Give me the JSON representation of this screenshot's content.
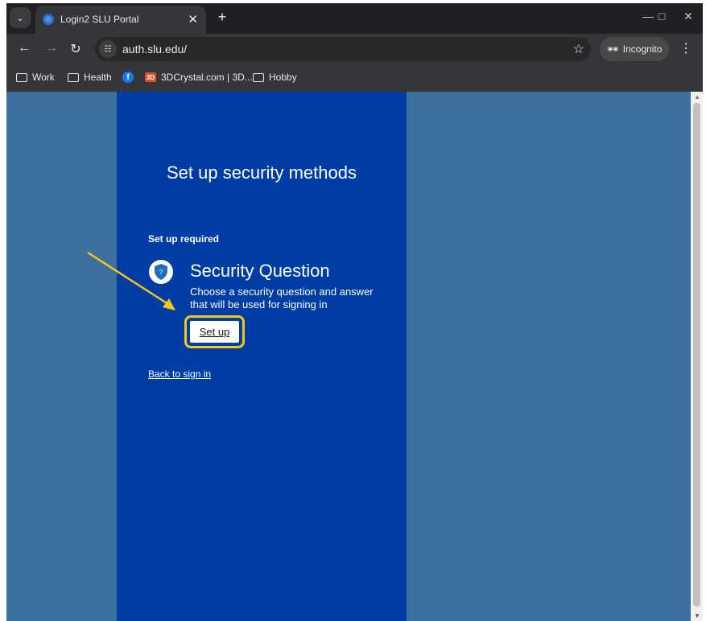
{
  "browser": {
    "tab_title": "Login2 SLU Portal",
    "url": "auth.slu.edu/",
    "incognito_label": "Incognito",
    "bookmarks": [
      {
        "label": "Work"
      },
      {
        "label": "Health"
      },
      {
        "label": ""
      },
      {
        "label": "3DCrystal.com | 3D..."
      },
      {
        "label": "Hobby"
      }
    ]
  },
  "page": {
    "heading": "Set up security methods",
    "subheading": "Set up required",
    "method": {
      "title": "Security Question",
      "description": "Choose a security question and answer that will be used for signing in",
      "setup_label": "Set up"
    },
    "back_link": "Back to sign in"
  },
  "colors": {
    "background": "#3d6f9f",
    "panel": "#003da5",
    "highlight": "#f5c518"
  }
}
